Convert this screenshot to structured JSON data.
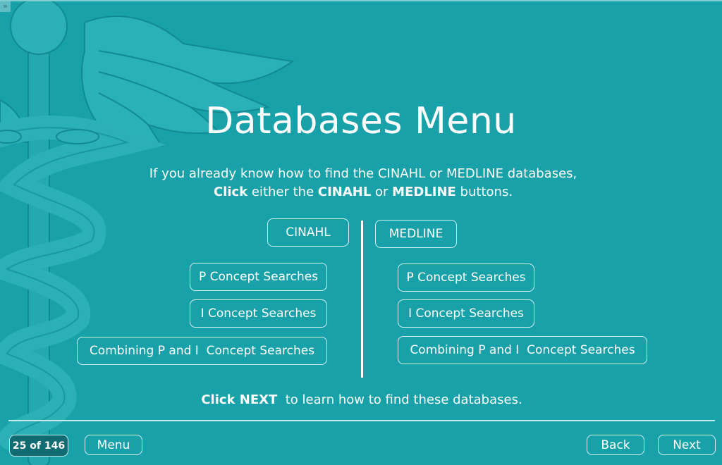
{
  "app": {
    "expand_glyph": "»"
  },
  "header": {
    "title": "Databases Menu"
  },
  "intro": {
    "line1": "If you already know how to find the CINAHL or MEDLINE databases,",
    "line2_parts": {
      "click": "Click",
      "either": " either the ",
      "cinahl": "CINAHL",
      "or": " or ",
      "medline": "MEDLINE",
      "buttons": " buttons."
    }
  },
  "columns": {
    "cinahl": {
      "header": "CINAHL",
      "items": [
        "P Concept Searches",
        "I Concept Searches",
        "Combining P and I  Concept Searches"
      ]
    },
    "medline": {
      "header": "MEDLINE",
      "items": [
        "P Concept Searches",
        "I Concept Searches",
        "Combining P and I  Concept Searches"
      ]
    }
  },
  "note": {
    "bold": "Click NEXT",
    "rest": "  to learn how to find these databases."
  },
  "footer": {
    "page_counter": "25 of 146",
    "menu_label": "Menu",
    "back_label": "Back",
    "next_label": "Next"
  },
  "colors": {
    "background": "#18a1a9",
    "text": "#ffffff",
    "counter_bg": "#106b72",
    "border": "#d6f1f2"
  }
}
